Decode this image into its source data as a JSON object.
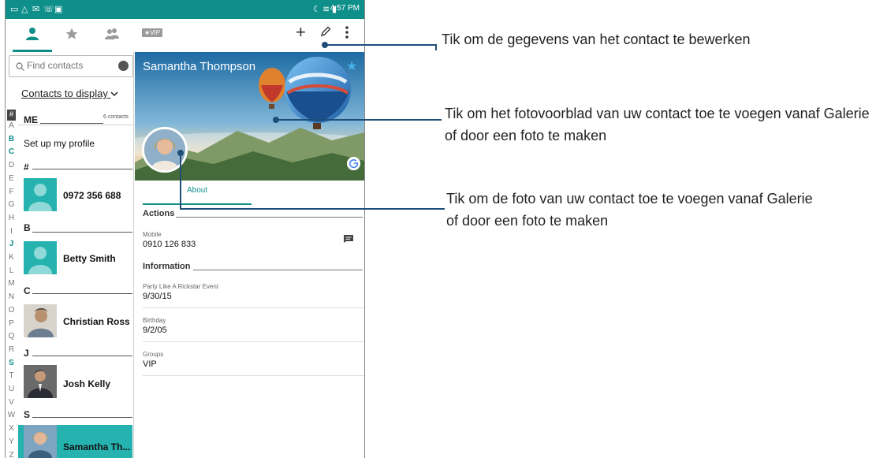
{
  "status_bar": {
    "time": "4:57 PM"
  },
  "tabs": [
    {
      "name": "contacts",
      "icon": "person-icon"
    },
    {
      "name": "favorites",
      "icon": "star-icon"
    },
    {
      "name": "groups",
      "icon": "group-icon"
    },
    {
      "name": "vip",
      "icon": "vip-icon",
      "label": "★VIP"
    }
  ],
  "toolbar": {
    "add_icon": "plus-icon",
    "edit_icon": "pencil-icon",
    "menu_icon": "overflow-menu-icon"
  },
  "search": {
    "placeholder": "Find contacts"
  },
  "display_filter": "Contacts to display",
  "alphabet": [
    "A",
    "B",
    "C",
    "D",
    "E",
    "F",
    "G",
    "H",
    "I",
    "J",
    "K",
    "L",
    "M",
    "N",
    "O",
    "P",
    "Q",
    "R",
    "S",
    "T",
    "U",
    "V",
    "W",
    "X",
    "Y",
    "Z"
  ],
  "alphabet_active": [
    "B",
    "C",
    "J",
    "S"
  ],
  "alphabet_hash": "#",
  "contact_list": {
    "me_header": "ME",
    "contacts_count": "6 contacts",
    "set_up_profile": "Set up my profile",
    "sections": {
      "hash": "#",
      "b": "B",
      "c": "C",
      "j": "J",
      "s": "S"
    },
    "rows": {
      "phone": "0972 356 688",
      "betty": "Betty Smith",
      "christian": "Christian Ross",
      "josh": "Josh Kelly",
      "samantha": "Samantha Th..."
    }
  },
  "contact_detail": {
    "name": "Samantha Thompson",
    "tab_about": "About",
    "actions_header": "Actions",
    "mobile_label": "Mobile",
    "mobile_value": "0910 126 833",
    "information_header": "Information",
    "fields": [
      {
        "label": "Party Like A Rickstar Event",
        "value": "9/30/15"
      },
      {
        "label": "Birthday",
        "value": "9/2/05"
      },
      {
        "label": "Groups",
        "value": "VIP"
      }
    ]
  },
  "annotations": [
    "Tik om de gegevens van het contact te bewerken",
    "Tik om het fotovoorblad van uw contact toe te voegen vanaf Galerie of door een foto te maken",
    "Tik om de foto van uw contact toe te voegen vanaf Galerie of door een foto te maken"
  ],
  "colors": {
    "accent": "#0f8f8a",
    "avatar_teal": "#26b3b0",
    "callout_line": "#1e4e78"
  }
}
